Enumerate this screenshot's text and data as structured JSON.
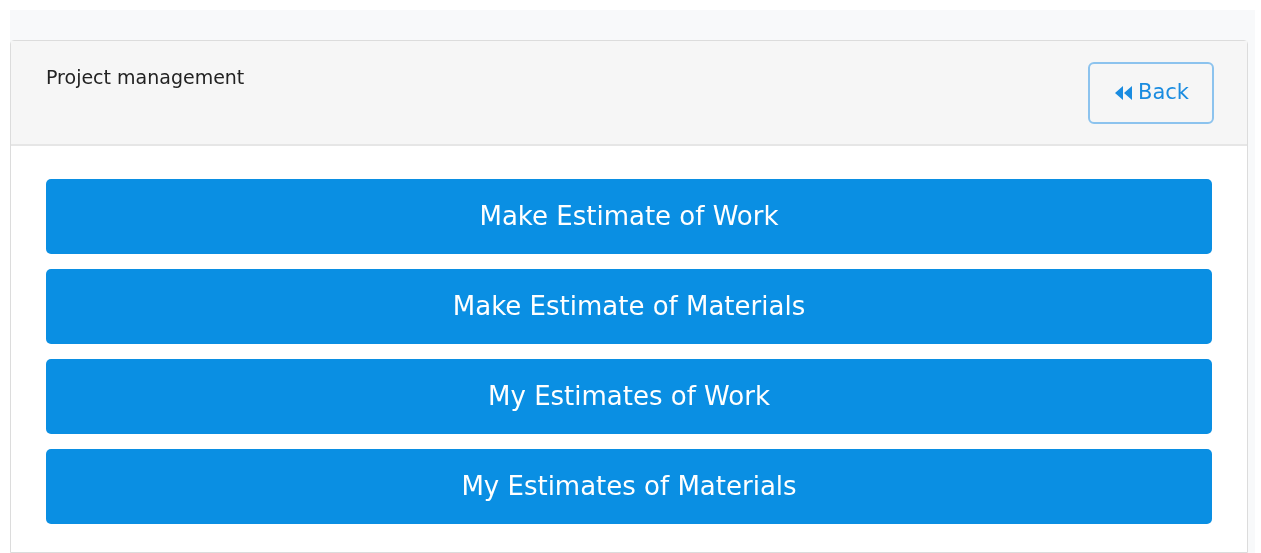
{
  "header": {
    "title": "Project management",
    "back_button": "Back"
  },
  "actions": [
    "Make Estimate of Work",
    "Make Estimate of Materials",
    "My Estimates of Work",
    "My Estimates of Materials"
  ]
}
